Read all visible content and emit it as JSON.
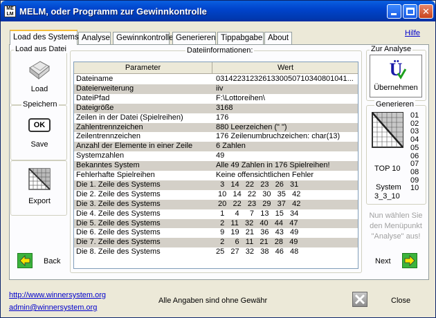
{
  "window": {
    "title": "MELM, oder Programm zur Gewinnkontrolle",
    "icon_text": "MELM"
  },
  "tabs": [
    {
      "label": "Load des Systems",
      "active": true
    },
    {
      "label": "Analyse"
    },
    {
      "label": "Gewinnkontrolle"
    },
    {
      "label": "Generieren"
    },
    {
      "label": "Tippabgabe"
    },
    {
      "label": "About"
    }
  ],
  "help_link": "Hilfe",
  "left": {
    "group_load": "Load aus Datei",
    "load_label": "Load",
    "group_save": "Speichern",
    "save_label": "Save",
    "ok_text": "OK",
    "export_label": "Export",
    "back_label": "Back"
  },
  "info": {
    "group_title": "Dateiinformationen:",
    "headers": [
      "Parameter",
      "Wert"
    ],
    "rows": [
      {
        "p": "Dateiname",
        "v": "0314223123261330050710340801041..."
      },
      {
        "p": "Dateierweiterung",
        "v": "iiv"
      },
      {
        "p": "DateiPfad",
        "v": "F:\\Lottoreihen\\"
      },
      {
        "p": "Dateigröße",
        "v": "3168"
      },
      {
        "p": "Zeilen in der Datei (Spielreihen)",
        "v": "176"
      },
      {
        "p": "Zahlentrennzeichen",
        "v": "880 Leerzeichen (\" \")"
      },
      {
        "p": "Zeilentrennzeichen",
        "v": "176 Zeilenumbruchzeichen: char(13)"
      },
      {
        "p": "Anzahl der Elemente in einer Zeile",
        "v": "6 Zahlen"
      },
      {
        "p": "Systemzahlen",
        "v": "49"
      },
      {
        "p": "Bekanntes System",
        "v": "Alle 49 Zahlen in 176 Spielreihen!"
      },
      {
        "p": "Fehlerhafte Spielreihen",
        "v": "Keine offensichtlichen Fehler"
      },
      {
        "p": "Die 1. Zeile des Systems",
        "v": "  3   14   22   23   26   31"
      },
      {
        "p": "Die 2. Zeile des Systems",
        "v": " 10   14   22   30   35   42"
      },
      {
        "p": "Die 3. Zeile des Systems",
        "v": " 20   22   23   29   37   42"
      },
      {
        "p": "Die 4. Zeile des Systems",
        "v": "  1     4     7   13   15   34"
      },
      {
        "p": "Die 5. Zeile des Systems",
        "v": "  2   11   32   40   44   47"
      },
      {
        "p": "Die 6. Zeile des Systems",
        "v": "  9   19   21   36   43   49"
      },
      {
        "p": "Die 7. Zeile des Systems",
        "v": "  2     6   11   21   28   49"
      },
      {
        "p": "Die 8. Zeile des Systems",
        "v": "25   27   32   38   46   48"
      }
    ]
  },
  "right": {
    "group_analyse": "Zur Analyse",
    "uebernehmen_label": "Übernehmen",
    "group_generieren": "Generieren",
    "top_label": "TOP 10",
    "system_label_1": "System",
    "system_label_2": "3_3_10",
    "numbers": [
      "01",
      "02",
      "03",
      "04",
      "05",
      "06",
      "07",
      "08",
      "09",
      "10"
    ],
    "hint_1": "Nun wählen Sie",
    "hint_2": "den Menüpunkt",
    "hint_3": "\"Analyse\" aus!",
    "next_label": "Next"
  },
  "footer": {
    "url": "http://www.winnersystem.org",
    "email": "admin@winnersystem.org",
    "disclaimer": "Alle Angaben sind ohne Gewähr",
    "close_label": "Close"
  }
}
